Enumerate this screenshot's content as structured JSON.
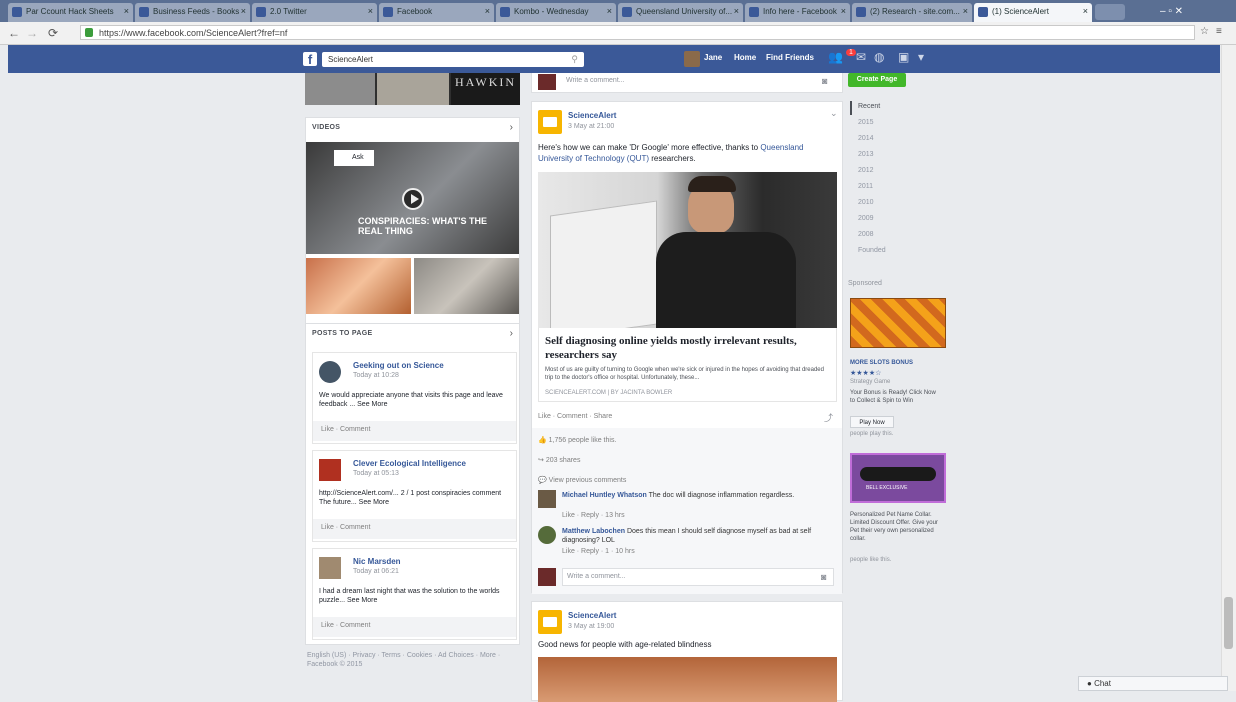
{
  "browser": {
    "tabs": [
      {
        "label": "Par Ccount Hack Sheets",
        "active": false
      },
      {
        "label": "Business Feeds - Books",
        "active": false
      },
      {
        "label": "2.0 Twitter",
        "active": false
      },
      {
        "label": "Facebook",
        "active": false
      },
      {
        "label": "Kombo - Wednesday",
        "active": false
      },
      {
        "label": "Queensland University of...",
        "active": false
      },
      {
        "label": "Info here - Facebook",
        "active": false
      },
      {
        "label": "(2) Research - site.com...",
        "active": false
      },
      {
        "label": "(1) ScienceAlert",
        "active": true
      }
    ],
    "url": "https://www.facebook.com/ScienceAlert?fref=nf"
  },
  "fb": {
    "search_value": "ScienceAlert",
    "user_name": "Jane",
    "nav_home": "Home",
    "nav_find_friends": "Find Friends",
    "notif_count": "1"
  },
  "left": {
    "banner_text": "HAWKIN",
    "videos_title": "VIDEOS",
    "video_label": "CONSPIRACIES: WHAT'S THE REAL THING",
    "posts_title": "POSTS TO PAGE",
    "posts": [
      {
        "name": "Geeking out on Science",
        "time": "Today at 10:28",
        "text": "We would appreciate anyone that visits this page and leave feedback ... See More",
        "actions": "Like · Comment"
      },
      {
        "name": "Clever Ecological Intelligence",
        "time": "Today at 05:13",
        "text": "http://ScienceAlert.com/... 2 / 1 post conspiracies comment The future... See More",
        "actions": "Like · Comment"
      },
      {
        "name": "Nic Marsden",
        "time": "Today at 06:21",
        "text": "I had a dream last night that was the solution to the worlds puzzle... See More",
        "actions": "Like · Comment"
      }
    ],
    "footer_links": "English (US) · Privacy · Terms · Cookies · Ad Choices · More · Facebook © 2015"
  },
  "center": {
    "write_comment": "Write a comment...",
    "post1": {
      "page": "ScienceAlert",
      "time": "3 May at 21:00",
      "text_plain": "Here's how we can make 'Dr Google' more effective, thanks to",
      "text_link": "Queensland University of Technology (QUT)",
      "text_end": " researchers.",
      "headline": "Self diagnosing online yields mostly irrelevant results, researchers say",
      "summary": "Most of us are guilty of turning to Google when we're sick or injured in the hopes of avoiding that dreaded trip to the doctor's office or hospital. Unfortunately, these...",
      "source": "SCIENCEALERT.COM | BY JACINTA BOWLER",
      "actions": "Like · Comment · Share",
      "likes": "1,756 people like this.",
      "shares": "203 shares",
      "view_prev": "View previous comments",
      "comments": [
        {
          "name": "Michael Huntley Whatson",
          "text": "The doc will diagnose inflammation regardless.",
          "meta": "Like · Reply · 13 hrs"
        },
        {
          "name": "Matthew Labochen",
          "text": "Does this mean I should self diagnose myself as bad at self diagnosing? LOL",
          "meta": "Like · Reply · 1 · 10 hrs"
        }
      ]
    },
    "post2": {
      "page": "ScienceAlert",
      "time": "3 May at 19:00",
      "text": "Good news for people with age-related blindness"
    }
  },
  "right": {
    "create_page": "Create Page",
    "years": [
      "Recent",
      "2015",
      "2014",
      "2013",
      "2012",
      "2011",
      "2010",
      "2009",
      "2008",
      "Founded"
    ],
    "sponsored": "Sponsored",
    "ad1_title": "MORE SLOTS BONUS",
    "ad1_sub": "Strategy Game",
    "ad1_text": "Your Bonus is Ready! Click Now to Collect & Spin to Win",
    "ad1_button": "Play Now",
    "ad1_likes": "people play this.",
    "ad2_title": "BELL EXCLUSIVE",
    "ad2_text": "Personalized Pet Name Collar. Limited Discount Offer. Give your Pet their very own personalized collar.",
    "ad2_likes": "people like this."
  },
  "chat_label": "Chat"
}
